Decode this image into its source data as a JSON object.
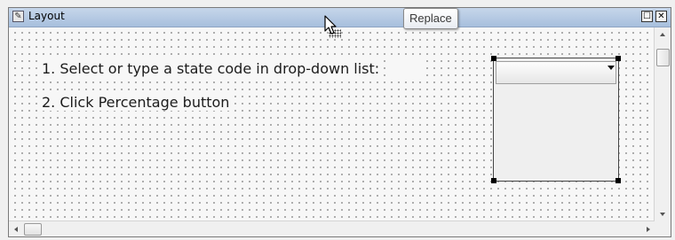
{
  "window": {
    "title": "Layout",
    "restore_label": "☐",
    "close_label": "✕"
  },
  "canvas": {
    "labels": [
      "1. Select or type a state code in drop-down list:",
      "2. Click Percentage button"
    ],
    "dropdown": {
      "value": "",
      "selected": true
    }
  },
  "tooltip": {
    "text": "Replace"
  },
  "icons": {
    "title": "form-icon",
    "cursor": "arrow-pointer-icon"
  },
  "colors": {
    "titlebar": "#b6cae3",
    "canvas": "#f7f7f7",
    "grid_dot": "#6b6b6b",
    "handle": "#000000"
  }
}
